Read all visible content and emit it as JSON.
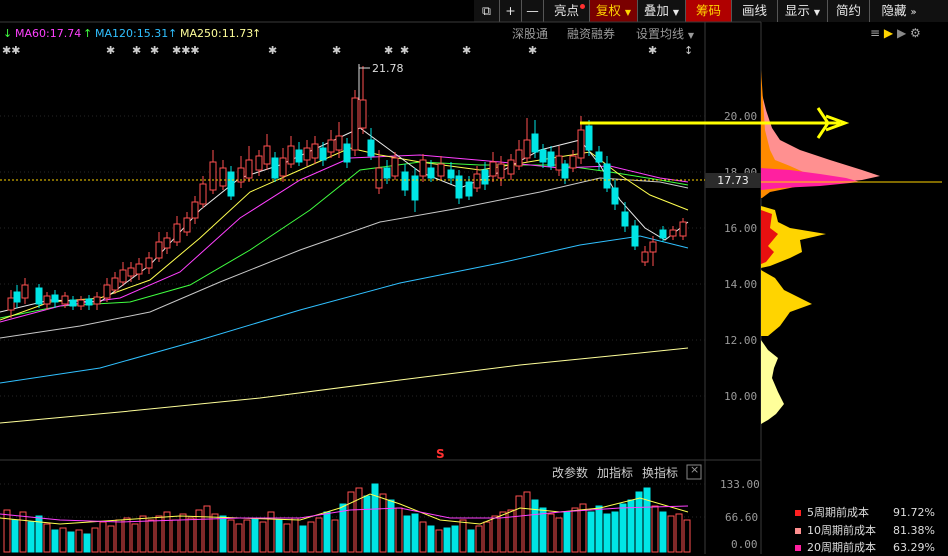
{
  "toolbar": {
    "items": [
      {
        "label": "⧉",
        "name": "detach-icon"
      },
      {
        "label": "+",
        "name": "zoom-in-button"
      },
      {
        "label": "—",
        "name": "zoom-out-button"
      },
      {
        "label": "亮点",
        "name": "highlight-button"
      },
      {
        "label": "复权",
        "name": "restore-rights-button"
      },
      {
        "label": "叠加",
        "name": "overlay-button"
      },
      {
        "label": "筹码",
        "name": "chips-button"
      },
      {
        "label": "画线",
        "name": "draw-line-button"
      },
      {
        "label": "显示",
        "name": "display-button"
      },
      {
        "label": "简约",
        "name": "simple-button"
      },
      {
        "label": "隐藏",
        "name": "hide-button"
      }
    ]
  },
  "ma_labels": {
    "ma60": "MA60:17.74",
    "ma120": "MA120:15.31",
    "ma250": "MA250:11.73"
  },
  "top_links": {
    "shengutong": "深股通",
    "margin": "融资融券",
    "set_ma": "设置均线"
  },
  "price_chart": {
    "y_axis_labels": [
      "20.00",
      "18.00",
      "16.00",
      "14.00",
      "12.00",
      "10.00"
    ],
    "current_price": "17.73",
    "high_annotation": "21.78",
    "marker_s": "S"
  },
  "volume_panel": {
    "controls": [
      "改参数",
      "加指标",
      "换指标"
    ],
    "close_label": "×",
    "y_axis_labels": [
      "133.00",
      "66.60",
      "0.00"
    ]
  },
  "chip_legend": [
    {
      "label": "5周期前成本",
      "value": "91.72%",
      "color": "#ff2020"
    },
    {
      "label": "10周期前成本",
      "value": "81.38%",
      "color": "#ff9090"
    },
    {
      "label": "20周期前成本",
      "value": "63.29%",
      "color": "#ff20a0"
    }
  ],
  "colors": {
    "up": "#ff5050",
    "down": "#00e5e5",
    "ma_white": "#e8e8e8",
    "ma_yellow": "#ffff50",
    "ma_magenta": "#ff40ff",
    "ma_green": "#40ff40",
    "ma_grey": "#c8c8c8",
    "ma_blue": "#30c0ff",
    "ma_pale_yellow": "#ffff9a",
    "arrow": "#ffff00"
  }
}
